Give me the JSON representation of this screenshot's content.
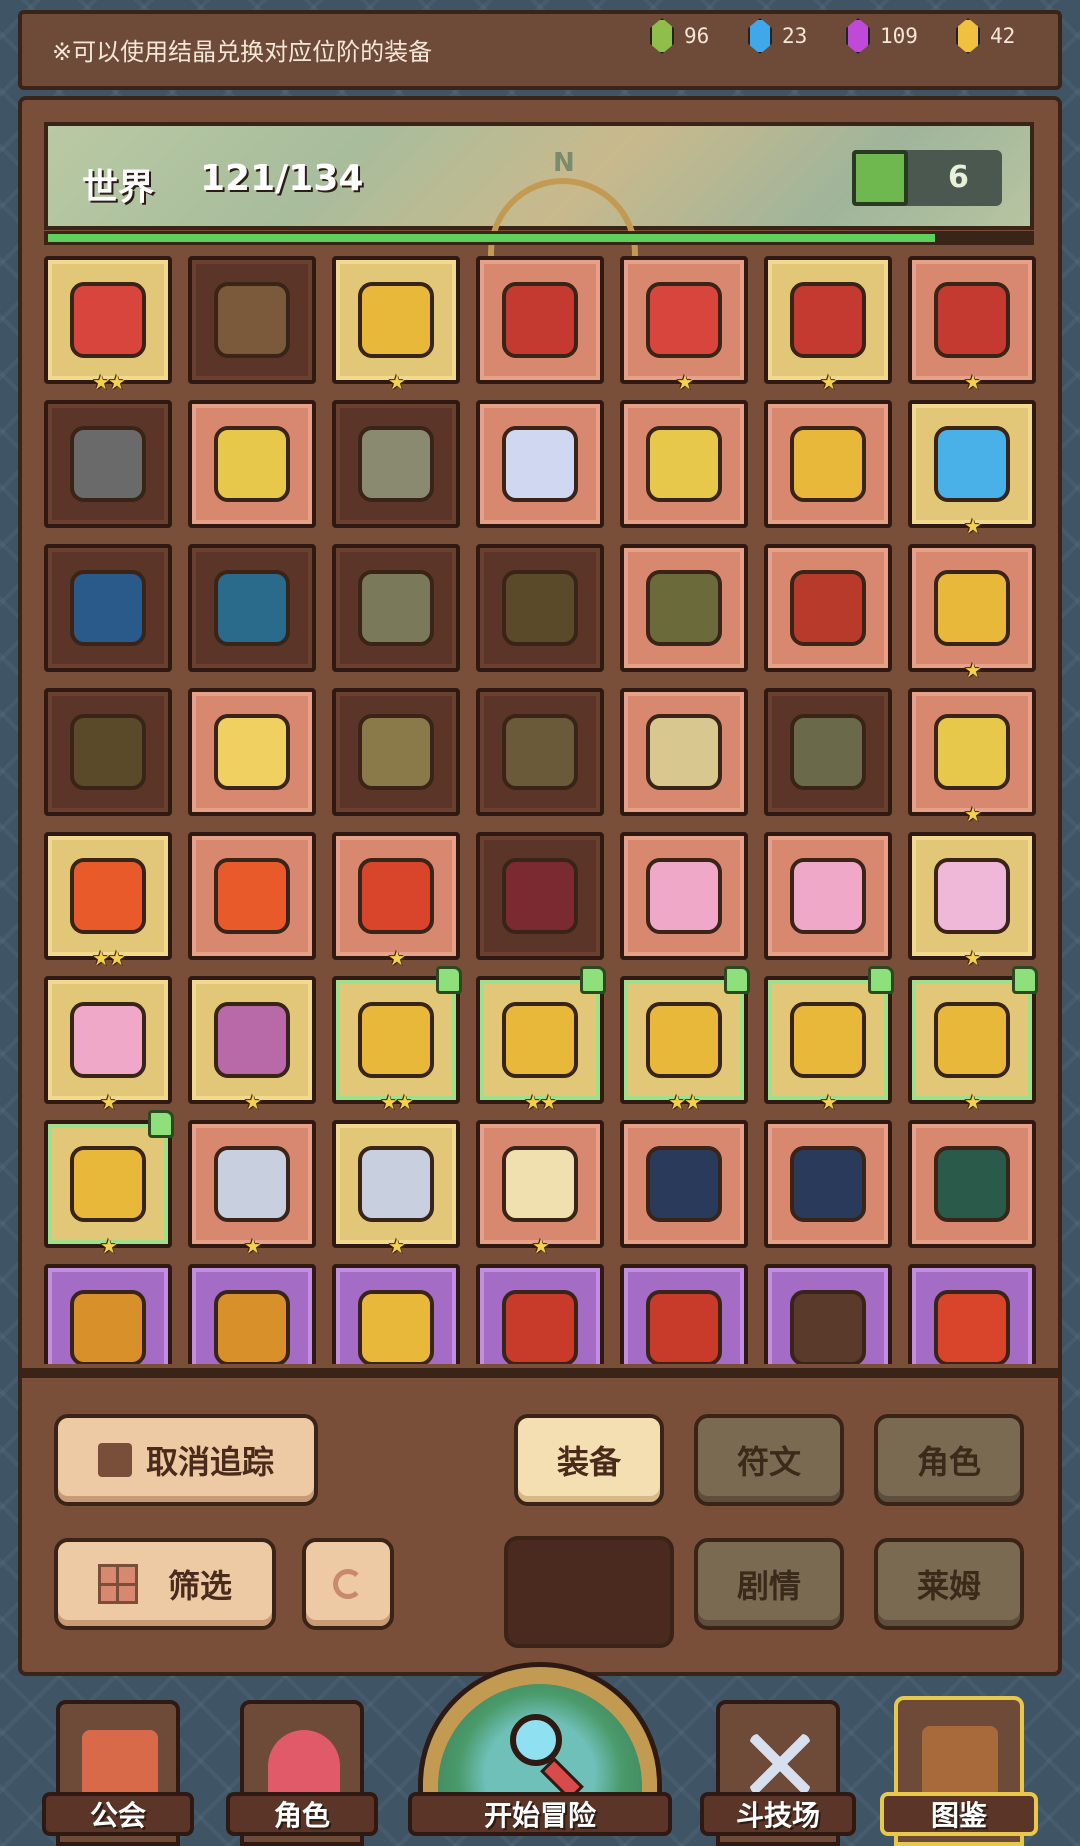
{
  "notice": "※可以使用结晶兑换对应位阶的装备",
  "currencies": [
    {
      "icon": "green-crystal-icon",
      "color": "#8fbf4a",
      "value": "96"
    },
    {
      "icon": "blue-crystal-icon",
      "color": "#3fa8e8",
      "value": "23"
    },
    {
      "icon": "purple-crystal-icon",
      "color": "#c04ad8",
      "value": "109"
    },
    {
      "icon": "gold-crystal-icon",
      "color": "#f0c040",
      "value": "42"
    }
  ],
  "collection": {
    "label": "世界",
    "count": "121/134",
    "progress": 0.903,
    "tracked_count": "6"
  },
  "items": [
    {
      "bg": "gold",
      "stars": "★★",
      "color": "#d8453c"
    },
    {
      "bg": "dark",
      "stars": "",
      "color": "#7a5a3a"
    },
    {
      "bg": "gold",
      "stars": "★",
      "color": "#e8b83a"
    },
    {
      "bg": "salmon",
      "stars": "",
      "color": "#c43a30"
    },
    {
      "bg": "salmon",
      "stars": "★",
      "color": "#d8453c"
    },
    {
      "bg": "gold",
      "stars": "★",
      "color": "#c43a30"
    },
    {
      "bg": "salmon",
      "stars": "★",
      "color": "#c43a30"
    },
    {
      "bg": "dark",
      "stars": "",
      "color": "#6a6a6a"
    },
    {
      "bg": "salmon",
      "stars": "",
      "color": "#e8c84a"
    },
    {
      "bg": "dark",
      "stars": "",
      "color": "#8a8a70"
    },
    {
      "bg": "salmon",
      "stars": "",
      "color": "#cfd8f0"
    },
    {
      "bg": "salmon",
      "stars": "",
      "color": "#e8c84a"
    },
    {
      "bg": "salmon",
      "stars": "",
      "color": "#e8b83a"
    },
    {
      "bg": "gold",
      "stars": "★",
      "color": "#4ab0e8"
    },
    {
      "bg": "dark",
      "stars": "",
      "color": "#2a5a8a"
    },
    {
      "bg": "dark",
      "stars": "",
      "color": "#2a6a8a"
    },
    {
      "bg": "dark",
      "stars": "",
      "color": "#7a7a5a"
    },
    {
      "bg": "dark",
      "stars": "",
      "color": "#5a4a2a"
    },
    {
      "bg": "salmon",
      "stars": "",
      "color": "#6a6a3a"
    },
    {
      "bg": "salmon",
      "stars": "",
      "color": "#b83a2a"
    },
    {
      "bg": "salmon",
      "stars": "★",
      "color": "#e8b83a"
    },
    {
      "bg": "dark",
      "stars": "",
      "color": "#5a4a2a"
    },
    {
      "bg": "salmon",
      "stars": "",
      "color": "#f0d060"
    },
    {
      "bg": "dark",
      "stars": "",
      "color": "#8a7a4a"
    },
    {
      "bg": "dark",
      "stars": "",
      "color": "#6a5a3a"
    },
    {
      "bg": "salmon",
      "stars": "",
      "color": "#d8c890"
    },
    {
      "bg": "dark",
      "stars": "",
      "color": "#6a6a4a"
    },
    {
      "bg": "salmon",
      "stars": "★",
      "color": "#e8c84a"
    },
    {
      "bg": "gold",
      "stars": "★★",
      "color": "#e85a2a"
    },
    {
      "bg": "salmon",
      "stars": "",
      "color": "#e85a2a"
    },
    {
      "bg": "salmon",
      "stars": "★",
      "color": "#d8452a"
    },
    {
      "bg": "dark",
      "stars": "",
      "color": "#7a2a30"
    },
    {
      "bg": "salmon",
      "stars": "",
      "color": "#f0a8c8"
    },
    {
      "bg": "salmon",
      "stars": "",
      "color": "#f0a8c8"
    },
    {
      "bg": "gold",
      "stars": "★",
      "color": "#f0b8d8"
    },
    {
      "bg": "gold",
      "stars": "★",
      "color": "#f0a8c8"
    },
    {
      "bg": "gold",
      "stars": "★",
      "color": "#b86aa8"
    },
    {
      "bg": "green",
      "stars": "★★",
      "color": "#e8b83a",
      "flag": true
    },
    {
      "bg": "green",
      "stars": "★★",
      "color": "#e8b83a",
      "flag": true
    },
    {
      "bg": "green",
      "stars": "★★",
      "color": "#e8b83a",
      "flag": true
    },
    {
      "bg": "green",
      "stars": "★",
      "color": "#e8b83a",
      "flag": true
    },
    {
      "bg": "green",
      "stars": "★",
      "color": "#e8b83a",
      "flag": true
    },
    {
      "bg": "green",
      "stars": "★",
      "color": "#e8b83a",
      "flag": true
    },
    {
      "bg": "salmon",
      "stars": "★",
      "color": "#c8d0e0"
    },
    {
      "bg": "gold",
      "stars": "★",
      "color": "#c8d0e0"
    },
    {
      "bg": "salmon",
      "stars": "★",
      "color": "#f0e0b0"
    },
    {
      "bg": "salmon",
      "stars": "",
      "color": "#2a3a5a"
    },
    {
      "bg": "salmon",
      "stars": "",
      "color": "#2a3a5a"
    },
    {
      "bg": "salmon",
      "stars": "",
      "color": "#2a5a4a"
    },
    {
      "bg": "purple",
      "stars": "",
      "color": "#d8902a"
    },
    {
      "bg": "purple",
      "stars": "",
      "color": "#d8902a"
    },
    {
      "bg": "purple",
      "stars": "",
      "color": "#e8b83a"
    },
    {
      "bg": "purple",
      "stars": "",
      "color": "#c83a2a"
    },
    {
      "bg": "purple",
      "stars": "",
      "color": "#c83a2a"
    },
    {
      "bg": "purple",
      "stars": "",
      "color": "#5a3a2a"
    },
    {
      "bg": "purple",
      "stars": "",
      "color": "#d8452a"
    }
  ],
  "controls": {
    "cancel_track": "取消追踪",
    "filter": "筛选",
    "tab_equipment": "装备",
    "tab_rune": "符文",
    "tab_character": "角色",
    "tab_story": "剧情",
    "tab_slime": "莱姆"
  },
  "nav": {
    "guild": "公会",
    "character": "角色",
    "adventure": "开始冒险",
    "arena": "斗技场",
    "codex": "图鉴"
  }
}
